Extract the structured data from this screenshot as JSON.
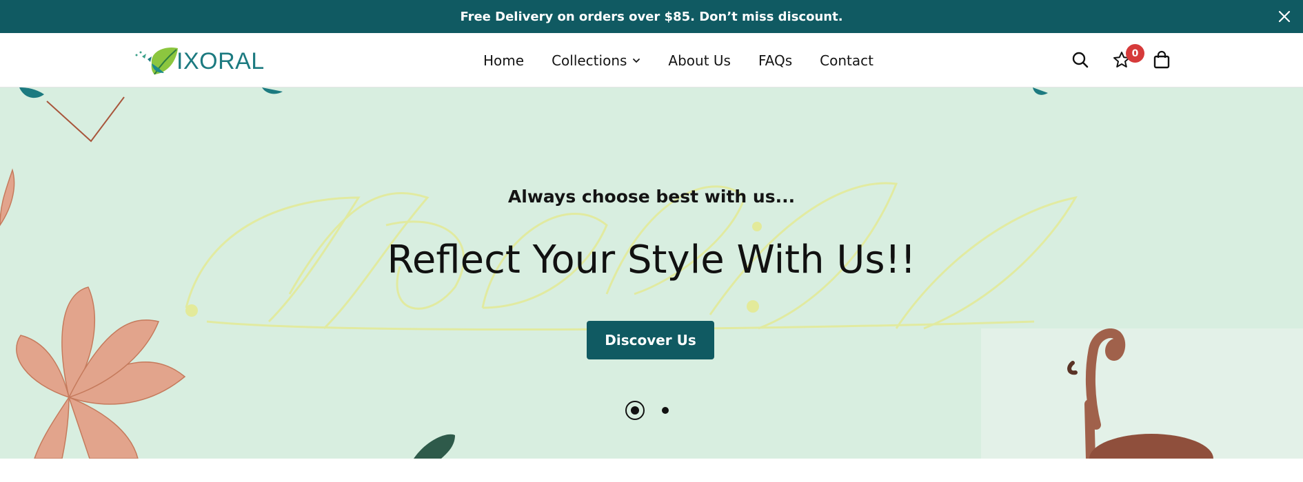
{
  "announcement": {
    "text": "Free Delivery on orders over $85. Don’t miss discount.",
    "close_icon": "close-icon",
    "background": "#105a62"
  },
  "header": {
    "logo_text": "IXORAL",
    "logo_icon": "leaf-logo-icon",
    "nav": [
      {
        "label": "Home"
      },
      {
        "label": "Collections",
        "has_dropdown": true
      },
      {
        "label": "About Us"
      },
      {
        "label": "FAQs"
      },
      {
        "label": "Contact"
      }
    ],
    "icons": {
      "search": "search-icon",
      "wishlist": "star-icon",
      "cart": "shopping-bag-icon"
    },
    "wishlist_count": "0",
    "badge_color": "#d63a3a"
  },
  "hero": {
    "subtitle": "Always choose best with us...",
    "title": "Reflect Your Style With Us!!",
    "button_label": "Discover Us",
    "watermark_text": "IXORAL",
    "slides": {
      "total": 2,
      "active": 1
    },
    "background": "#d8eee0",
    "accent": "#105a62"
  }
}
